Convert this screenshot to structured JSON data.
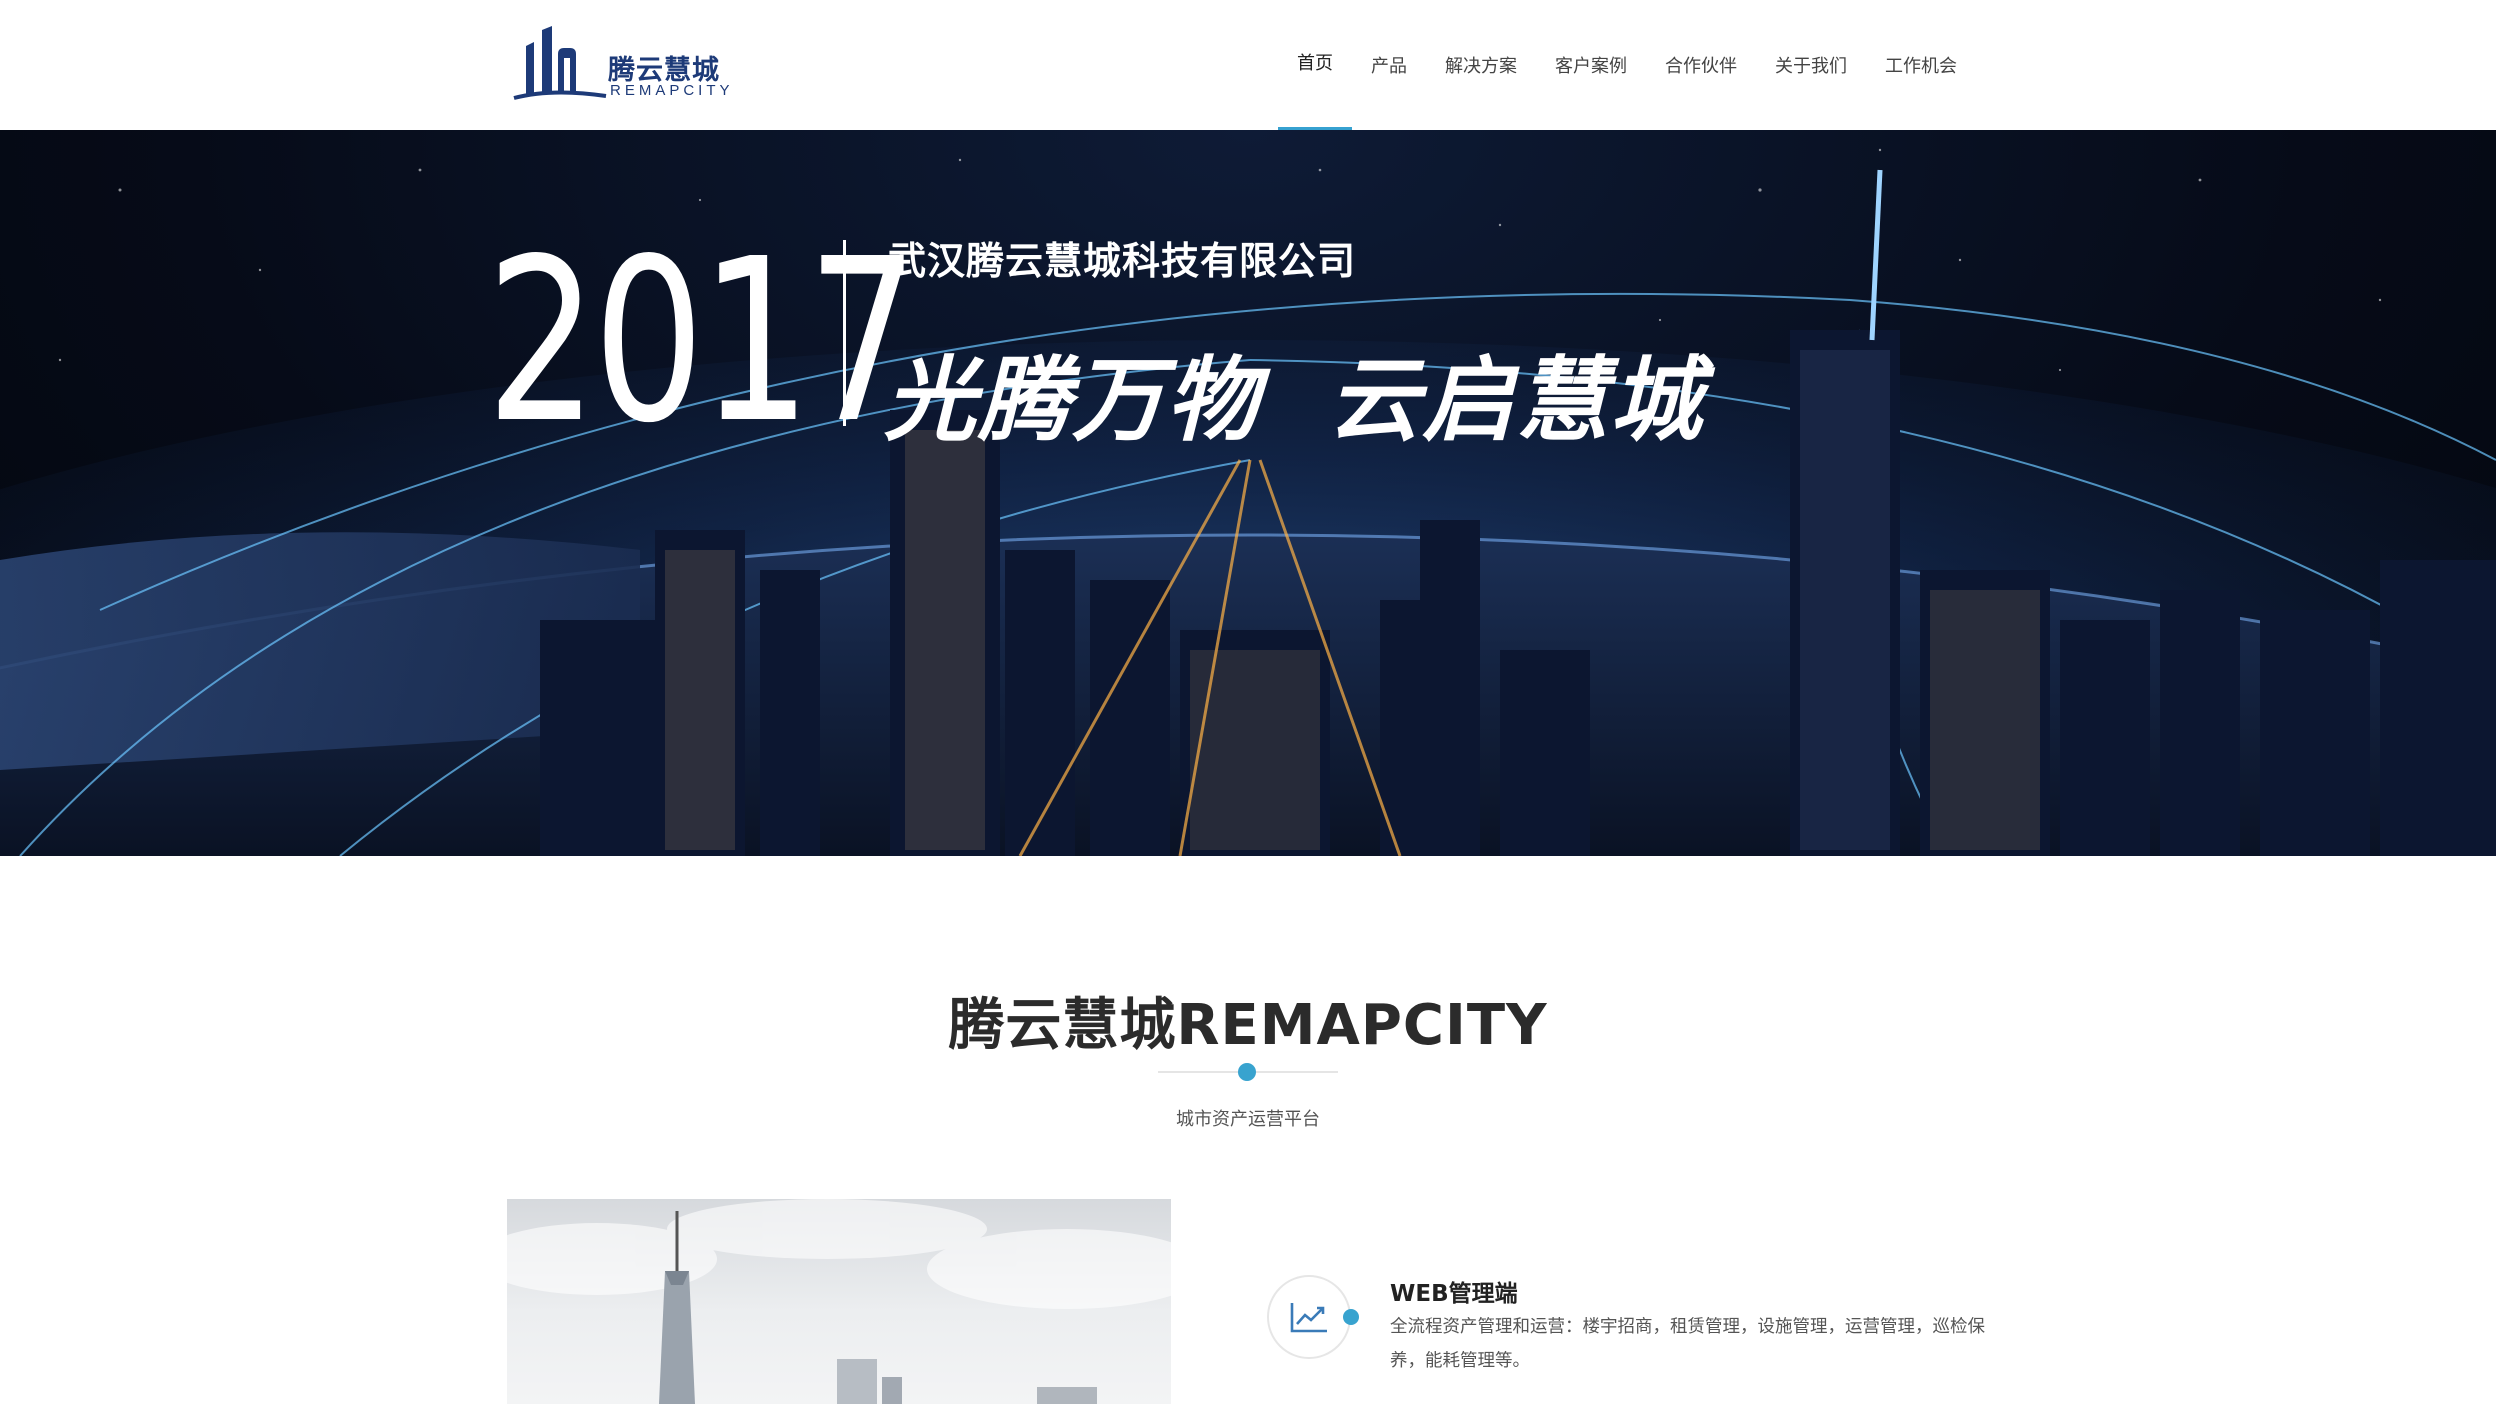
{
  "brand": {
    "logo_cn": "腾云慧城",
    "logo_en": "REMAPCITY"
  },
  "nav": {
    "items": [
      {
        "label": "首页"
      },
      {
        "label": "产品"
      },
      {
        "label": "解决方案"
      },
      {
        "label": "客户案例"
      },
      {
        "label": "合作伙伴"
      },
      {
        "label": "关于我们"
      },
      {
        "label": "工作机会"
      }
    ],
    "active_index": 0
  },
  "hero": {
    "year": "2017",
    "company": "武汉腾云慧城科技有限公司",
    "slogan": "光腾万物  云启慧城"
  },
  "intro": {
    "title": "腾云慧城REMAPCITY",
    "subtitle": "城市资产运营平台"
  },
  "feature": {
    "icon": "trend-chart-icon",
    "title": "WEB管理端",
    "description": "全流程资产管理和运营：楼宇招商，租赁管理，设施管理，运营管理，巡检保养，能耗管理等。"
  },
  "colors": {
    "brand_navy": "#1d3a78",
    "accent_blue": "#38a3cf"
  }
}
